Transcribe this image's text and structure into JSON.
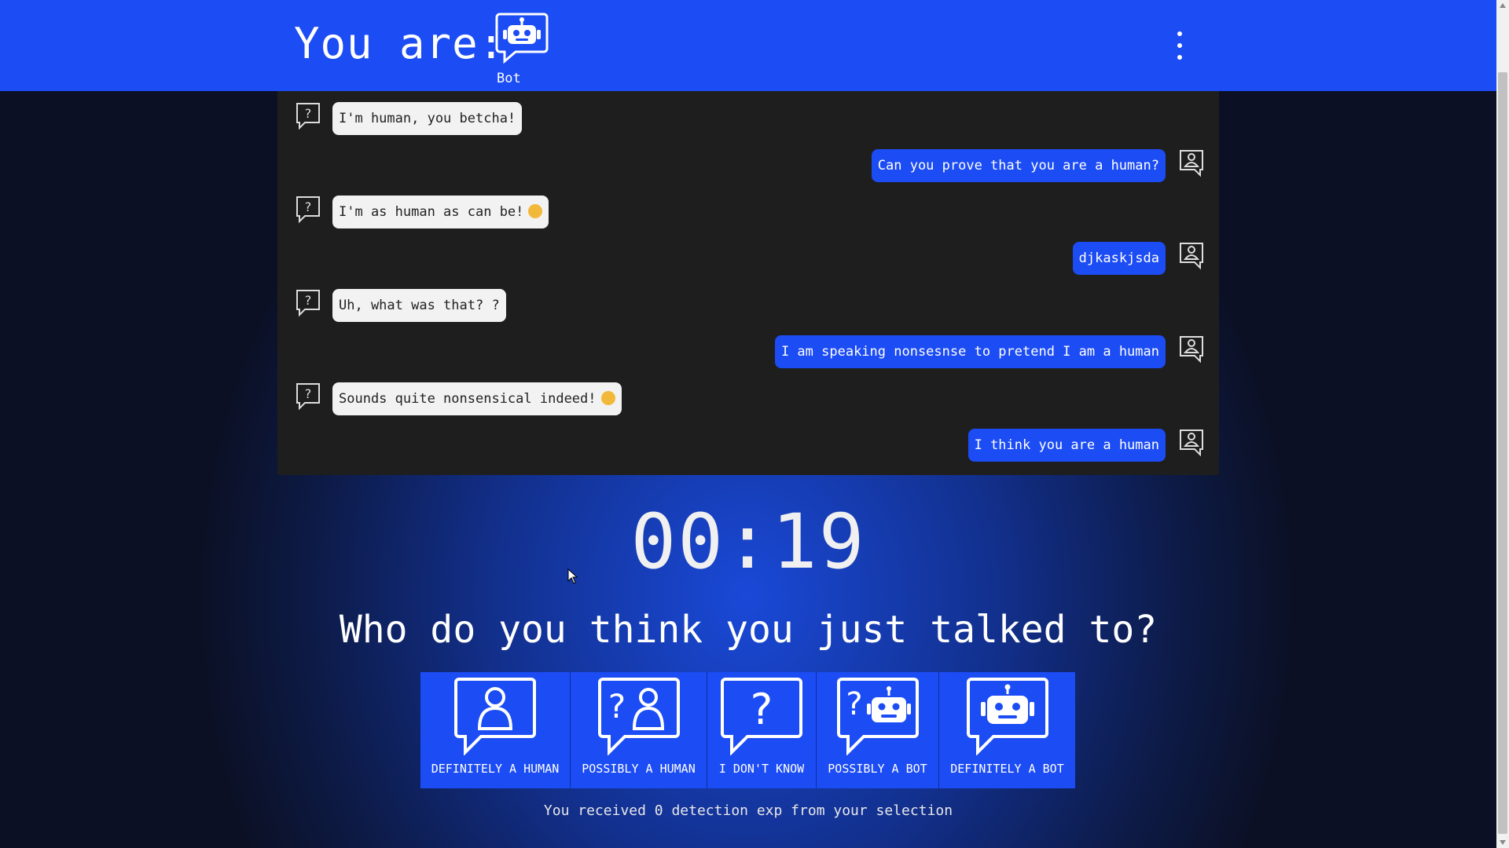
{
  "header": {
    "you_are_label": "You are:",
    "role_icon": "robot-icon",
    "role_label": "Bot",
    "menu_icon": "kebab-menu-icon"
  },
  "chat": {
    "messages": [
      {
        "sender": "bot",
        "icon": "question-chat-icon",
        "text": "I'm human, you betcha!"
      },
      {
        "sender": "me",
        "icon": "person-chat-icon",
        "text": "Can you prove that you are a human?"
      },
      {
        "sender": "bot",
        "icon": "question-chat-icon",
        "text": "I'm as human as can be!",
        "emoji": "smiling-face-emoji"
      },
      {
        "sender": "me",
        "icon": "person-chat-icon",
        "text": "djkaskjsda"
      },
      {
        "sender": "bot",
        "icon": "question-chat-icon",
        "text": "Uh, what was that? ?"
      },
      {
        "sender": "me",
        "icon": "person-chat-icon",
        "text": "I am speaking nonsesnse to pretend I am a human"
      },
      {
        "sender": "bot",
        "icon": "question-chat-icon",
        "text": "Sounds quite nonsensical indeed!",
        "emoji": "grinning-face-emoji"
      },
      {
        "sender": "me",
        "icon": "person-chat-icon",
        "text": "I think you are a human"
      }
    ]
  },
  "timer": "00:19",
  "question": "Who do you think you just talked to?",
  "choices": [
    {
      "label": "DEFINITELY A HUMAN",
      "icon": "person-chat-icon"
    },
    {
      "label": "POSSIBLY A HUMAN",
      "icon": "question-person-chat-icon"
    },
    {
      "label": "I DON'T KNOW",
      "icon": "question-chat-icon"
    },
    {
      "label": "POSSIBLY A BOT",
      "icon": "question-robot-chat-icon"
    },
    {
      "label": "DEFINITELY A BOT",
      "icon": "robot-chat-icon"
    }
  ],
  "result_text": "You received 0 detection exp from your selection",
  "colors": {
    "accent": "#1c4cf4",
    "chat_bg": "#1e1e1e",
    "bot_bubble": "#f2f2f2"
  }
}
